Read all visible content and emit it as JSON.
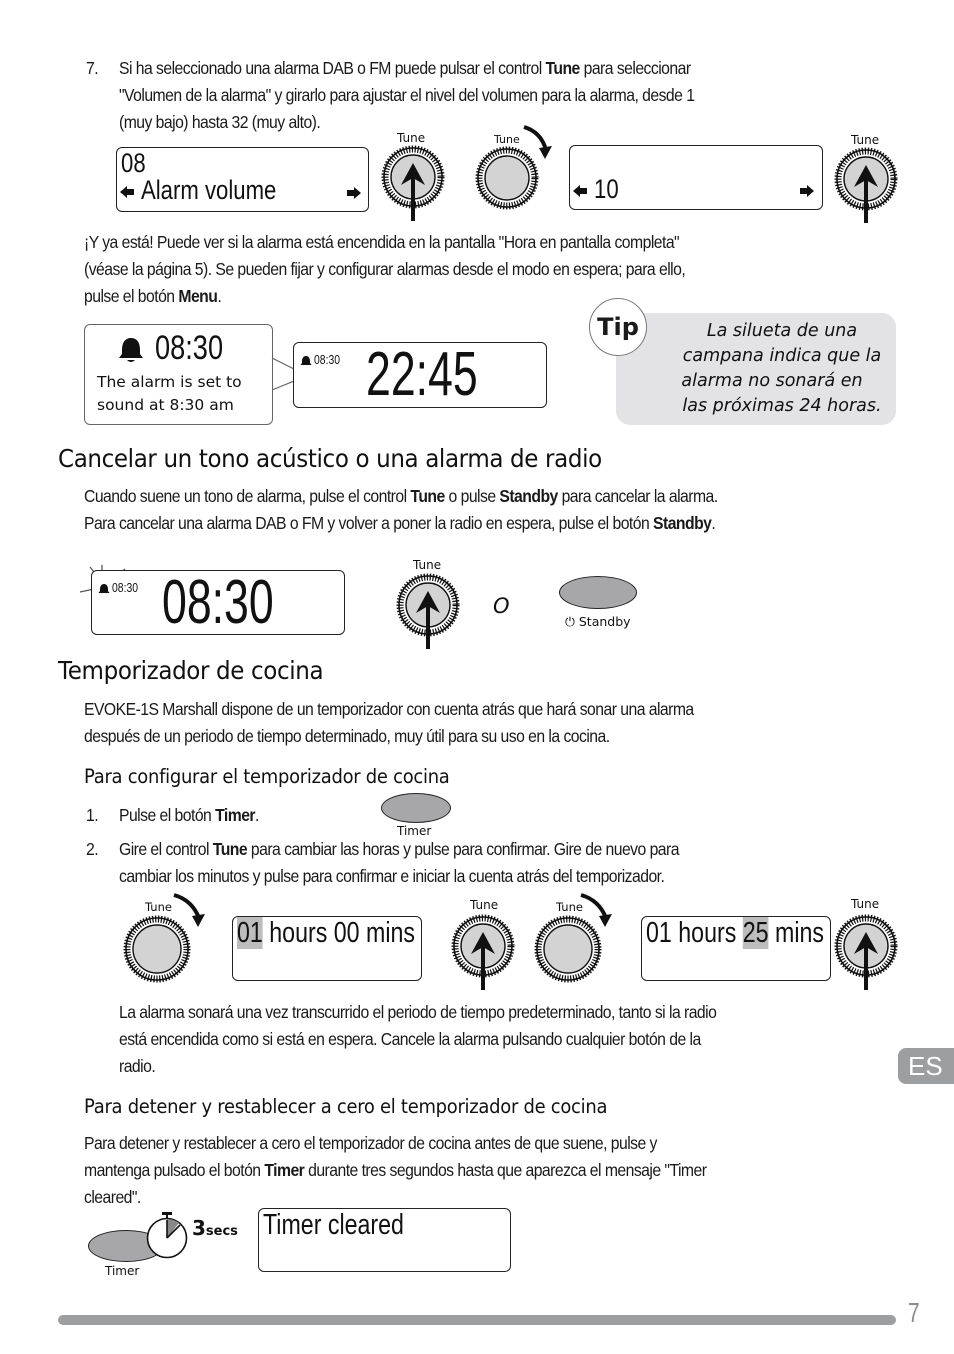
{
  "step7": {
    "number": "7.",
    "line1_pre": "Si ha seleccionado una alarma DAB o FM puede pulsar el control ",
    "line1_bold": "Tune",
    "line1_post": " para seleccionar",
    "line2": "\"Volumen de la alarma\" y girarlo para ajustar el nivel del volumen para la alarma, desde 1",
    "line3": "(muy bajo) hasta 32 (muy alto)."
  },
  "volume_figure": {
    "display1_line1": "08",
    "display1_line2": "Alarm volume",
    "display2_value": "10",
    "knob_label": "Tune",
    "arrow_left_icon": "left-arrow",
    "arrow_right_icon": "right-arrow"
  },
  "done_paragraph": {
    "line1": "¡Y ya está! Puede ver si la alarma está encendida en la pantalla \"Hora en pantalla completa\"",
    "line2": "(véase la página 5). Se pueden fijar y configurar alarmas desde el modo en espera; para ello,",
    "line3_pre": "pulse el botón ",
    "line3_bold": "Menu",
    "line3_post": "."
  },
  "alarm_display_figure": {
    "callout_time": "08:30",
    "callout_line1": "The alarm is set to",
    "callout_line2": "sound at 8:30 am",
    "small_alarm_time": "08:30",
    "clock_time": "22:45"
  },
  "tip": {
    "badge": "Tip",
    "lines": [
      "La silueta de una",
      "campana indica que la",
      "alarma no sonará en",
      "las próximas 24 horas."
    ]
  },
  "section_cancel": {
    "heading": "Cancelar un tono acústico o una alarma de radio",
    "line1_a": "Cuando suene un tono de alarma, pulse el control ",
    "line1_b": "Tune",
    "line1_c": " o pulse ",
    "line1_d": "Standby",
    "line1_e": " para cancelar la alarma.",
    "line2_a": "Para cancelar una alarma DAB o FM y volver a poner la radio en espera, pulse el botón ",
    "line2_b": "Standby",
    "line2_c": ".",
    "figure": {
      "small_alarm_time": "08:30",
      "clock_time": "08:30",
      "knob_label": "Tune",
      "or_text": "O",
      "standby_label": "Standby"
    }
  },
  "section_timer": {
    "heading": "Temporizador de cocina",
    "intro_line1": "EVOKE-1S Marshall dispone de un temporizador con cuenta atrás que hará sonar una alarma",
    "intro_line2": "después de un periodo de tiempo determinado, muy útil para su uso en la cocina.",
    "subheading_config": "Para configurar el temporizador de cocina",
    "step1_number": "1.",
    "step1_pre": "Pulse el botón ",
    "step1_bold": "Timer",
    "step1_post": ".",
    "timer_button_label": "Timer",
    "step2_number": "2.",
    "step2_line1_pre": "Gire el control ",
    "step2_line1_bold": "Tune",
    "step2_line1_post": " para cambiar las horas y pulse para confirmar. Gire de nuevo para",
    "step2_line2": "cambiar los minutos y pulse para confirmar e iniciar la cuenta atrás del temporizador.",
    "figure": {
      "knob_label": "Tune",
      "display1": {
        "hours": "01",
        "hours_word": " hours ",
        "mins": "00",
        "mins_word": " mins"
      },
      "display2": {
        "hours": "01",
        "hours_word": " hours ",
        "mins": "25",
        "mins_word": " mins"
      }
    },
    "note_line1": "La alarma sonará una vez transcurrido el periodo de tiempo predeterminado, tanto si la radio",
    "note_line2": "está encendida como si está en espera. Cancele la alarma pulsando cualquier botón de la",
    "note_line3": "radio.",
    "subheading_reset": "Para detener y restablecer a cero el temporizador de cocina",
    "reset_line1": "Para detener y restablecer a cero el temporizador de cocina antes de que suene, pulse y",
    "reset_line2_pre": "mantenga pulsado el botón ",
    "reset_line2_bold": "Timer",
    "reset_line2_post": " durante tres segundos hasta que aparezca el mensaje \"Timer",
    "reset_line3": "cleared\".",
    "reset_figure": {
      "hold_number": "3",
      "hold_unit": "secs",
      "timer_label": "Timer",
      "display_text": "Timer cleared"
    }
  },
  "side_tab": {
    "language": "ES"
  },
  "footer": {
    "page_number": "7"
  },
  "colors": {
    "tip_background": "#e3e3e5",
    "tab_gray": "#9d9ea0",
    "button_gray": "#a7a7a9",
    "highlight": "#bdbdbd"
  }
}
